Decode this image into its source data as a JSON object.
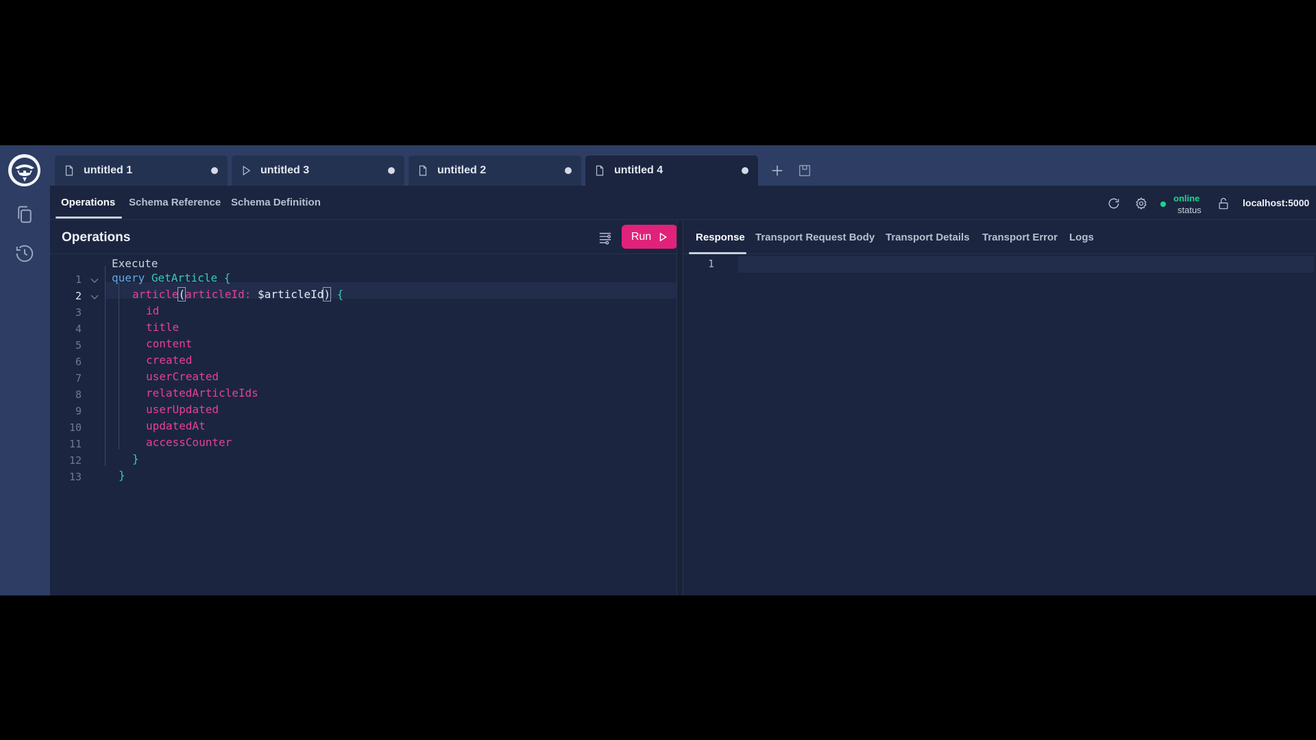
{
  "tabs": [
    {
      "label": "untitled 1",
      "icon": "file-icon",
      "modified": true,
      "active": false
    },
    {
      "label": "untitled 3",
      "icon": "play-icon",
      "modified": true,
      "active": false
    },
    {
      "label": "untitled 2",
      "icon": "file-icon",
      "modified": true,
      "active": false
    },
    {
      "label": "untitled 4",
      "icon": "file-icon",
      "modified": true,
      "active": true
    }
  ],
  "nav": {
    "tabs": [
      "Operations",
      "Schema Reference",
      "Schema Definition"
    ],
    "active": "Operations"
  },
  "connection": {
    "status": "online",
    "status_label": "status",
    "endpoint": "localhost:5000"
  },
  "operations": {
    "title": "Operations",
    "run_label": "Run",
    "code_lens": "Execute",
    "lines": [
      {
        "n": "1",
        "kw": "query",
        "name": "GetArticle",
        "punc": "{"
      },
      {
        "n": "2",
        "field": "article",
        "arg": "articleId:",
        "var": "$articleId",
        "punc": "{"
      },
      {
        "n": "3",
        "field": "id"
      },
      {
        "n": "4",
        "field": "title"
      },
      {
        "n": "5",
        "field": "content"
      },
      {
        "n": "6",
        "field": "created"
      },
      {
        "n": "7",
        "field": "userCreated"
      },
      {
        "n": "8",
        "field": "relatedArticleIds"
      },
      {
        "n": "9",
        "field": "userUpdated"
      },
      {
        "n": "10",
        "field": "updatedAt"
      },
      {
        "n": "11",
        "field": "accessCounter"
      },
      {
        "n": "12",
        "punc": "}"
      },
      {
        "n": "13",
        "punc": "}"
      }
    ]
  },
  "response": {
    "tabs": [
      "Response",
      "Transport Request Body",
      "Transport Details",
      "Transport Error",
      "Logs"
    ],
    "active": "Response",
    "line_number": "1"
  },
  "colors": {
    "accent": "#e0227a",
    "online": "#1ed38c",
    "background": "#1b2540",
    "rail": "#2d3d63"
  }
}
